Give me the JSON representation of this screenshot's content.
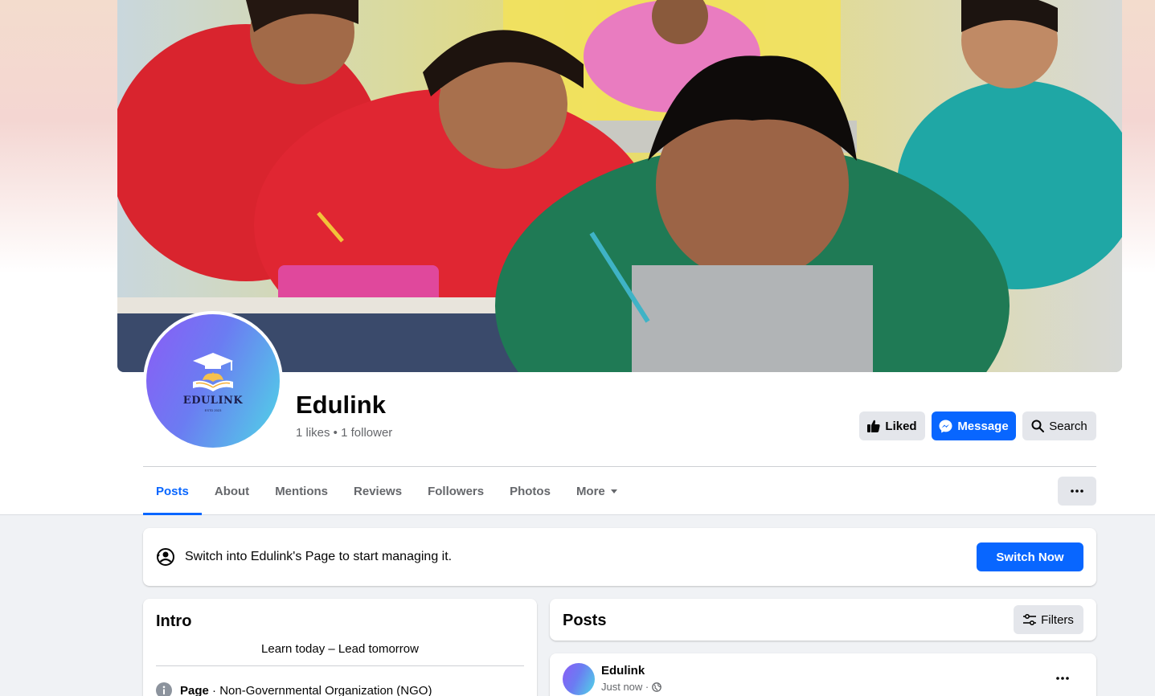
{
  "page": {
    "name": "Edulink",
    "stats": "1 likes • 1 follower",
    "logo_text": "EDULINK",
    "logo_subtext": "ESTD 2023"
  },
  "actions": {
    "liked": "Liked",
    "message": "Message",
    "search": "Search"
  },
  "tabs": [
    {
      "label": "Posts",
      "active": true
    },
    {
      "label": "About"
    },
    {
      "label": "Mentions"
    },
    {
      "label": "Reviews"
    },
    {
      "label": "Followers"
    },
    {
      "label": "Photos"
    },
    {
      "label": "More"
    }
  ],
  "switch_banner": {
    "text": "Switch into Edulink's Page to start managing it.",
    "button": "Switch Now"
  },
  "intro": {
    "title": "Intro",
    "bio": "Learn today – Lead tomorrow",
    "category_label": "Page",
    "category_value": " · Non-Governmental Organization (NGO)"
  },
  "posts": {
    "title": "Posts",
    "filters_label": "Filters",
    "items": [
      {
        "author": "Edulink",
        "time": "Just now ·"
      }
    ]
  },
  "colors": {
    "accent": "#0866ff",
    "button_gray": "#e4e6eb",
    "background": "#f0f2f5"
  }
}
